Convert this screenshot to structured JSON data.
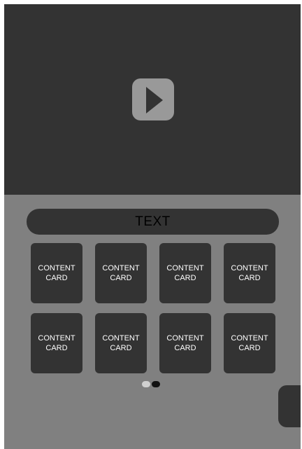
{
  "video": {
    "play_icon": "play-icon"
  },
  "text_bar": {
    "label": "TEXT"
  },
  "cards": [
    {
      "line1": "CONTENT",
      "line2": "CARD"
    },
    {
      "line1": "CONTENT",
      "line2": "CARD"
    },
    {
      "line1": "CONTENT",
      "line2": "CARD"
    },
    {
      "line1": "CONTENT",
      "line2": "CARD"
    },
    {
      "line1": "CONTENT",
      "line2": "CARD"
    },
    {
      "line1": "CONTENT",
      "line2": "CARD"
    },
    {
      "line1": "CONTENT",
      "line2": "CARD"
    },
    {
      "line1": "CONTENT",
      "line2": "CARD"
    }
  ],
  "pager": {
    "page_count": 2,
    "active_page": 2
  },
  "colors": {
    "background": "#808080",
    "panel": "#333333",
    "play_button": "#999999"
  }
}
